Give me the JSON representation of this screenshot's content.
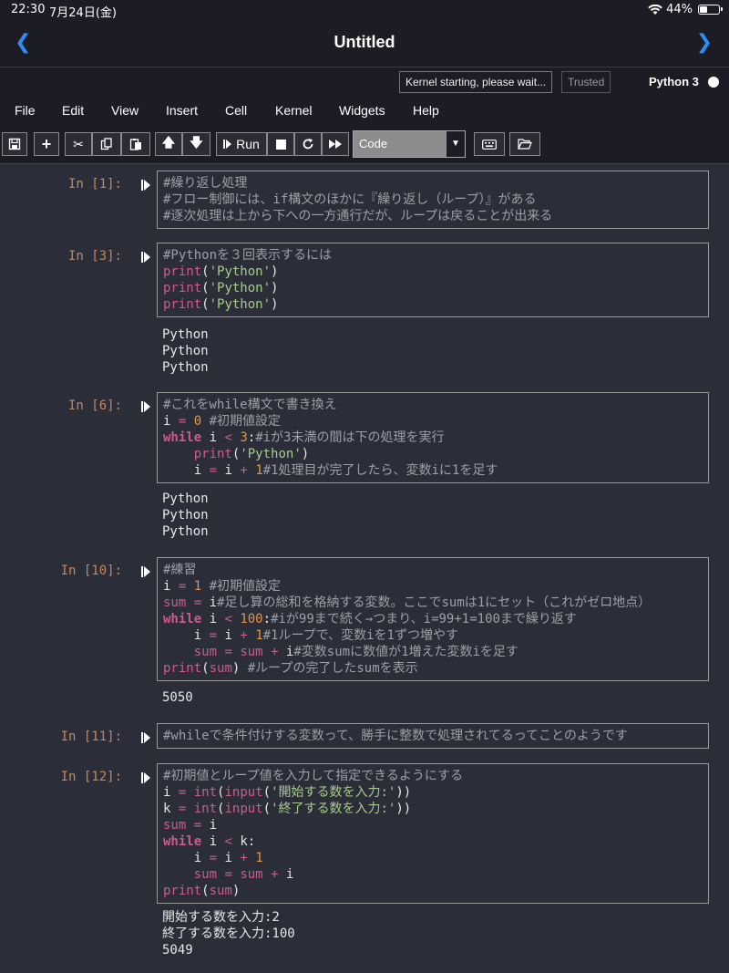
{
  "status": {
    "time": "22:30",
    "date": "7月24日(金)",
    "battery": "44%",
    "battery_level": 0.44
  },
  "nav": {
    "title": "Untitled",
    "back_icon": "chevron-left-icon",
    "forward_icon": "chevron-right-icon"
  },
  "kernel": {
    "message": "Kernel starting, please wait...",
    "trusted": "Trusted",
    "name": "Python 3"
  },
  "menu": [
    "File",
    "Edit",
    "View",
    "Insert",
    "Cell",
    "Kernel",
    "Widgets",
    "Help"
  ],
  "toolbar": {
    "run_label": "Run",
    "cell_type": "Code"
  },
  "cells": [
    {
      "prompt": "In [1]:",
      "lines": [
        [
          [
            "cm",
            "#繰り返し処理"
          ]
        ],
        [
          [
            "cm",
            "#フロー制御には、if構文のほかに『繰り返し（ループ）』がある"
          ]
        ],
        [
          [
            "cm",
            "#逐次処理は上から下への一方通行だが、ループは戻ることが出来る"
          ]
        ]
      ],
      "output": []
    },
    {
      "prompt": "In [3]:",
      "lines": [
        [
          [
            "cm",
            "#Pythonを３回表示するには"
          ]
        ],
        [
          [
            "fn",
            "print"
          ],
          [
            "tx",
            "("
          ],
          [
            "st",
            "'Python'"
          ],
          [
            "tx",
            ")"
          ]
        ],
        [
          [
            "fn",
            "print"
          ],
          [
            "tx",
            "("
          ],
          [
            "st",
            "'Python'"
          ],
          [
            "tx",
            ")"
          ]
        ],
        [
          [
            "fn",
            "print"
          ],
          [
            "tx",
            "("
          ],
          [
            "st",
            "'Python'"
          ],
          [
            "tx",
            ")"
          ]
        ]
      ],
      "output": [
        "Python",
        "Python",
        "Python"
      ]
    },
    {
      "prompt": "In [6]:",
      "lines": [
        [
          [
            "cm",
            "#これをwhile構文で書き換え"
          ]
        ],
        [
          [
            "tx",
            "i "
          ],
          [
            "op",
            "="
          ],
          [
            "tx",
            " "
          ],
          [
            "nm",
            "0"
          ],
          [
            "tx",
            " "
          ],
          [
            "cm",
            "#初期値設定"
          ]
        ],
        [
          [
            "kw",
            "while"
          ],
          [
            "tx",
            " i "
          ],
          [
            "op",
            "<"
          ],
          [
            "tx",
            " "
          ],
          [
            "nm",
            "3"
          ],
          [
            "tx",
            ":"
          ],
          [
            "cm",
            "#iが3未満の間は下の処理を実行"
          ]
        ],
        [
          [
            "tx",
            "    "
          ],
          [
            "fn",
            "print"
          ],
          [
            "tx",
            "("
          ],
          [
            "st",
            "'Python'"
          ],
          [
            "tx",
            ")"
          ]
        ],
        [
          [
            "tx",
            "    i "
          ],
          [
            "op",
            "="
          ],
          [
            "tx",
            " i "
          ],
          [
            "op",
            "+"
          ],
          [
            "tx",
            " "
          ],
          [
            "nm",
            "1"
          ],
          [
            "cm",
            "#1処理目が完了したら、変数iに1を足す"
          ]
        ]
      ],
      "output": [
        "Python",
        "Python",
        "Python"
      ]
    },
    {
      "prompt": "In [10]:",
      "lines": [
        [
          [
            "cm",
            "#練習"
          ]
        ],
        [
          [
            "tx",
            "i "
          ],
          [
            "op",
            "="
          ],
          [
            "tx",
            " "
          ],
          [
            "nm",
            "1"
          ],
          [
            "tx",
            " "
          ],
          [
            "cm",
            "#初期値設定"
          ]
        ],
        [
          [
            "fn",
            "sum"
          ],
          [
            "tx",
            " "
          ],
          [
            "op",
            "="
          ],
          [
            "tx",
            " i"
          ],
          [
            "cm",
            "#足し算の総和を格納する変数。ここでsumは1にセット（これがゼロ地点）"
          ]
        ],
        [
          [
            "kw",
            "while"
          ],
          [
            "tx",
            " i "
          ],
          [
            "op",
            "<"
          ],
          [
            "tx",
            " "
          ],
          [
            "nm",
            "100"
          ],
          [
            "tx",
            ":"
          ],
          [
            "cm",
            "#iが99まで続く→つまり、i=99+1=100まで繰り返す"
          ]
        ],
        [
          [
            "tx",
            "    i "
          ],
          [
            "op",
            "="
          ],
          [
            "tx",
            " i "
          ],
          [
            "op",
            "+"
          ],
          [
            "tx",
            " "
          ],
          [
            "nm",
            "1"
          ],
          [
            "cm",
            "#1ループで、変数iを1ずつ増やす"
          ]
        ],
        [
          [
            "tx",
            "    "
          ],
          [
            "fn",
            "sum"
          ],
          [
            "tx",
            " "
          ],
          [
            "op",
            "="
          ],
          [
            "tx",
            " "
          ],
          [
            "fn",
            "sum"
          ],
          [
            "tx",
            " "
          ],
          [
            "op",
            "+"
          ],
          [
            "tx",
            " i"
          ],
          [
            "cm",
            "#変数sumに数値が1増えた変数iを足す"
          ]
        ],
        [
          [
            "fn",
            "print"
          ],
          [
            "tx",
            "("
          ],
          [
            "fn",
            "sum"
          ],
          [
            "tx",
            ") "
          ],
          [
            "cm",
            "#ループの完了したsumを表示"
          ]
        ]
      ],
      "output": [
        "5050"
      ]
    },
    {
      "prompt": "In [11]:",
      "lines": [
        [
          [
            "cm",
            "#whileで条件付けする変数って、勝手に整数で処理されてるってことのようです"
          ]
        ]
      ],
      "output": []
    },
    {
      "prompt": "In [12]:",
      "lines": [
        [
          [
            "cm",
            "#初期値とループ値を入力して指定できるようにする"
          ]
        ],
        [
          [
            "tx",
            "i "
          ],
          [
            "op",
            "="
          ],
          [
            "tx",
            " "
          ],
          [
            "fn",
            "int"
          ],
          [
            "tx",
            "("
          ],
          [
            "fn",
            "input"
          ],
          [
            "tx",
            "("
          ],
          [
            "st",
            "'開始する数を入力:'"
          ],
          [
            "tx",
            "))"
          ]
        ],
        [
          [
            "tx",
            "k "
          ],
          [
            "op",
            "="
          ],
          [
            "tx",
            " "
          ],
          [
            "fn",
            "int"
          ],
          [
            "tx",
            "("
          ],
          [
            "fn",
            "input"
          ],
          [
            "tx",
            "("
          ],
          [
            "st",
            "'終了する数を入力:'"
          ],
          [
            "tx",
            "))"
          ]
        ],
        [
          [
            "fn",
            "sum"
          ],
          [
            "tx",
            " "
          ],
          [
            "op",
            "="
          ],
          [
            "tx",
            " i"
          ]
        ],
        [
          [
            "kw",
            "while"
          ],
          [
            "tx",
            " i "
          ],
          [
            "op",
            "<"
          ],
          [
            "tx",
            " k:"
          ]
        ],
        [
          [
            "tx",
            "    i "
          ],
          [
            "op",
            "="
          ],
          [
            "tx",
            " i "
          ],
          [
            "op",
            "+"
          ],
          [
            "tx",
            " "
          ],
          [
            "nm",
            "1"
          ]
        ],
        [
          [
            "tx",
            "    "
          ],
          [
            "fn",
            "sum"
          ],
          [
            "tx",
            " "
          ],
          [
            "op",
            "="
          ],
          [
            "tx",
            " "
          ],
          [
            "fn",
            "sum"
          ],
          [
            "tx",
            " "
          ],
          [
            "op",
            "+"
          ],
          [
            "tx",
            " i"
          ]
        ],
        [
          [
            "fn",
            "print"
          ],
          [
            "tx",
            "("
          ],
          [
            "fn",
            "sum"
          ],
          [
            "tx",
            ")"
          ]
        ]
      ],
      "output": [
        "開始する数を入力:2",
        "終了する数を入力:100",
        "5049"
      ]
    }
  ]
}
